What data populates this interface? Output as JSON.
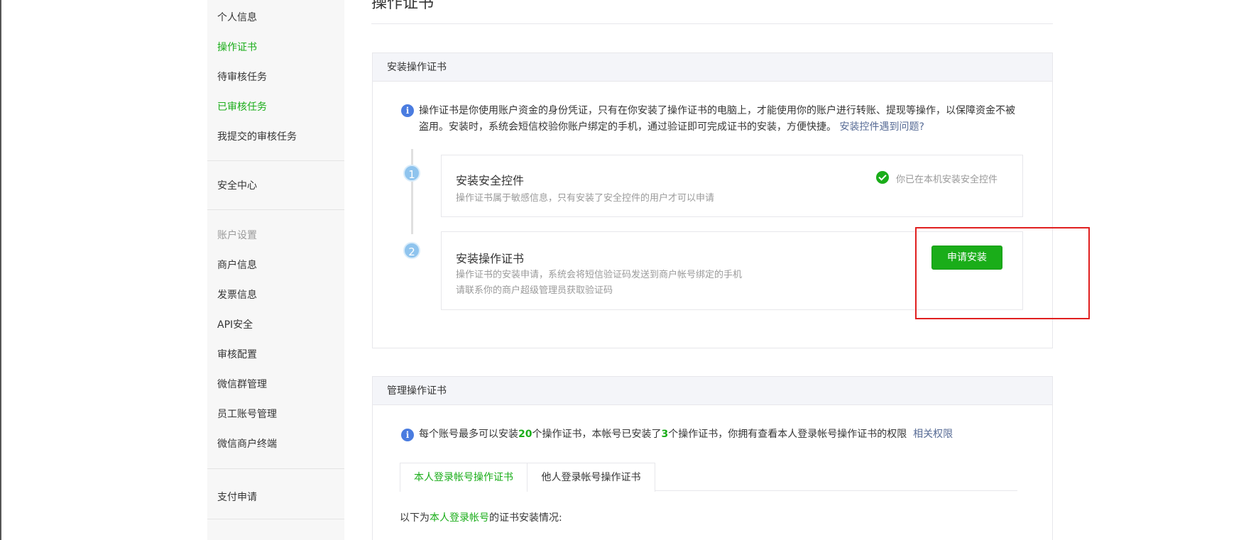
{
  "page_title": "操作证书",
  "sidebar": {
    "items": [
      {
        "label": "个人信息"
      },
      {
        "label": "操作证书"
      },
      {
        "label": "待审核任务"
      },
      {
        "label": "已审核任务"
      },
      {
        "label": "我提交的审核任务"
      },
      {
        "label": "安全中心"
      },
      {
        "label": "账户设置"
      },
      {
        "label": "商户信息"
      },
      {
        "label": "发票信息"
      },
      {
        "label": "API安全"
      },
      {
        "label": "审核配置"
      },
      {
        "label": "微信群管理"
      },
      {
        "label": "员工账号管理"
      },
      {
        "label": "微信商户终端"
      },
      {
        "label": "支付申请"
      }
    ]
  },
  "install_card": {
    "header": "安装操作证书",
    "notice_line1": "操作证书是你使用账户资金的身份凭证，只有在你安装了操作证书的电脑上，才能使用你的账户进行转账、提现等操作，以保障资金不被",
    "notice_line2": "盗用。安装时，系统会短信校验你账户绑定的手机，通过验证即可完成证书的安装，方便快捷。",
    "notice_link": "安装控件遇到问题?",
    "steps": [
      {
        "number": "1",
        "title": "安装安全控件",
        "desc": "操作证书属于敏感信息，只有安装了安全控件的用户才可以申请",
        "status": "你已在本机安装安全控件"
      },
      {
        "number": "2",
        "title": "安装操作证书",
        "desc1": "操作证书的安装申请，系统会将短信验证码发送到商户帐号绑定的手机",
        "desc2": "请联系你的商户超级管理员获取验证码",
        "button": "申请安装"
      }
    ]
  },
  "manage_card": {
    "header": "管理操作证书",
    "notice_part1": "每个账号最多可以安装",
    "max_count": "20",
    "notice_part2": "个操作证书，本帐号已安装了",
    "installed_count": "3",
    "notice_part3": "个操作证书，你拥有查看本人登录帐号操作证书的权限",
    "notice_link": "相关权限",
    "tabs": [
      {
        "label": "本人登录帐号操作证书"
      },
      {
        "label": "他人登录帐号操作证书"
      }
    ],
    "cert_line_prefix": "以下为",
    "cert_line_highlight": "本人登录帐号",
    "cert_line_suffix": "的证书安装情况:"
  },
  "colors": {
    "accent_green": "#1aad19",
    "link_blue": "#576b95",
    "info_blue": "#4a7ce0",
    "highlight_red": "#e02020"
  },
  "icons": {
    "info": "info-icon",
    "check": "check-circle-icon"
  }
}
